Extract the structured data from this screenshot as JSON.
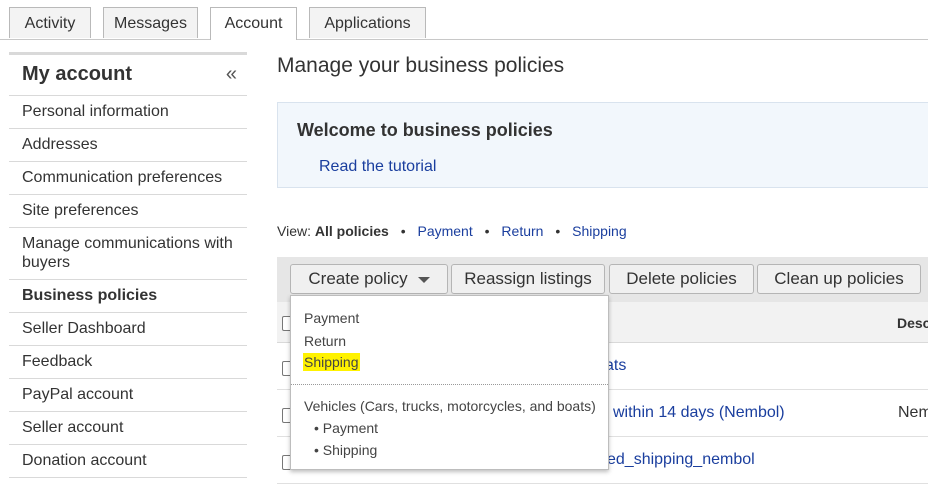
{
  "tabs": [
    {
      "label": "Activity"
    },
    {
      "label": "Messages"
    },
    {
      "label": "Account"
    },
    {
      "label": "Applications"
    }
  ],
  "sidebar": {
    "title": "My account",
    "collapse_glyph": "«",
    "items": [
      {
        "label": "Personal information"
      },
      {
        "label": "Addresses"
      },
      {
        "label": "Communication preferences"
      },
      {
        "label": "Site preferences"
      },
      {
        "label": "Manage communications with buyers"
      },
      {
        "label": "Business policies"
      },
      {
        "label": "Seller Dashboard"
      },
      {
        "label": "Feedback"
      },
      {
        "label": "PayPal account"
      },
      {
        "label": "Seller account"
      },
      {
        "label": "Donation account"
      }
    ]
  },
  "main": {
    "title": "Manage your business policies",
    "welcome": {
      "title": "Welcome to business policies",
      "link": "Read the tutorial"
    },
    "view": {
      "prefix": "View:",
      "current": "All policies",
      "links": [
        "Payment",
        "Return",
        "Shipping"
      ],
      "separator": "•"
    },
    "toolbar": {
      "create": "Create policy",
      "reassign": "Reassign listings",
      "delete": "Delete policies",
      "cleanup": "Clean up policies"
    },
    "table": {
      "header_desc": "Desc",
      "rows": [
        {
          "link": "ats",
          "desc": ""
        },
        {
          "link": "within 14 days (Nembol)",
          "desc": "Nem"
        },
        {
          "link": "ed_shipping_nembol",
          "desc": ""
        }
      ]
    }
  },
  "dropdown": {
    "items": [
      "Payment",
      "Return",
      "Shipping"
    ],
    "highlighted": "Shipping",
    "group_title": "Vehicles (Cars, trucks, motorcycles, and boats)",
    "group_items": [
      "• Payment",
      "• Shipping"
    ]
  },
  "colors": {
    "link": "#1a3e9e",
    "highlight": "#fff200",
    "welcome_bg": "#f2f7fc"
  }
}
